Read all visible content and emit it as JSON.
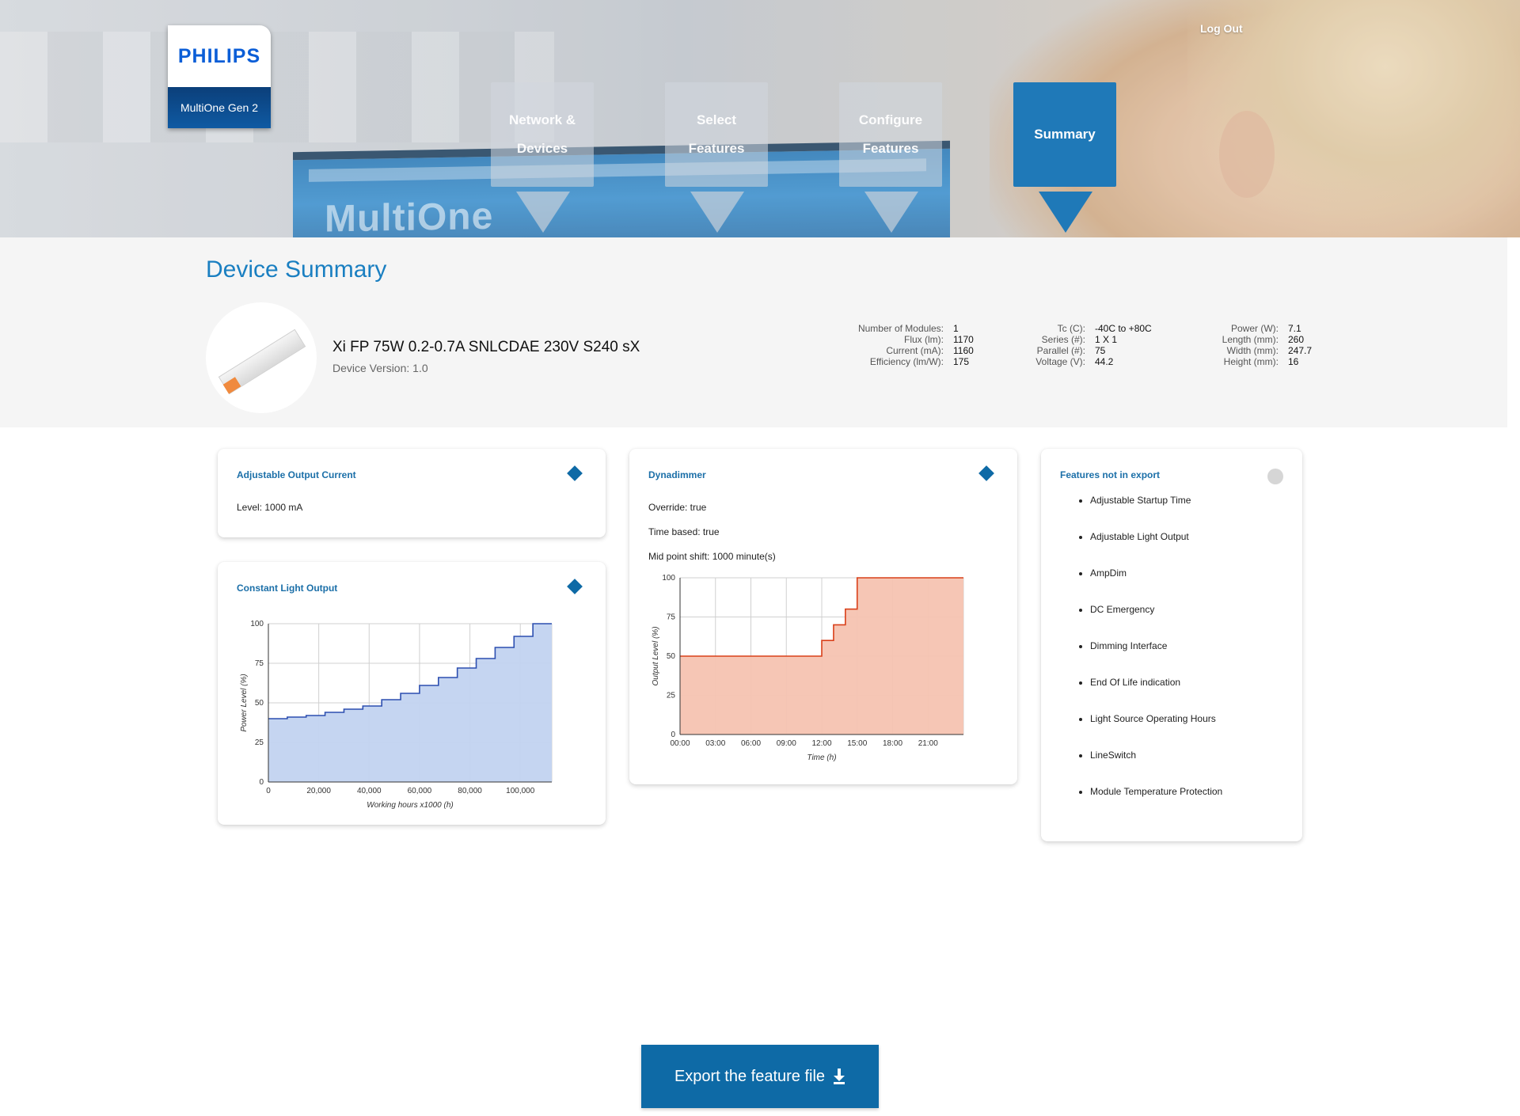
{
  "header": {
    "logo": {
      "brand": "PHILIPS",
      "product": "MultiOne Gen 2"
    },
    "background_screen_text": "MultiOne",
    "logout_label": "Log Out",
    "steps": [
      {
        "line1": "Network &",
        "line2": "Devices",
        "active": false
      },
      {
        "line1": "Select",
        "line2": "Features",
        "active": false
      },
      {
        "line1": "Configure",
        "line2": "Features",
        "active": false
      },
      {
        "line1": "Summary",
        "line2": "",
        "active": true
      }
    ]
  },
  "device": {
    "section_title": "Device Summary",
    "name": "Xi FP 75W 0.2-0.7A SNLCDAE 230V S240 sX",
    "version": "Device Version: 1.0",
    "specs": [
      [
        {
          "label": "Number of Modules:",
          "value": "1"
        },
        {
          "label": "Flux (lm):",
          "value": "1170"
        },
        {
          "label": "Current (mA):",
          "value": "1160"
        },
        {
          "label": "Efficiency (lm/W):",
          "value": "175"
        }
      ],
      [
        {
          "label": "Tc (C):",
          "value": "-40C to +80C"
        },
        {
          "label": "Series (#):",
          "value": "1 X 1"
        },
        {
          "label": "Parallel (#):",
          "value": "75"
        },
        {
          "label": "Voltage (V):",
          "value": "44.2"
        }
      ],
      [
        {
          "label": "Power (W):",
          "value": "7.1"
        },
        {
          "label": "Length (mm):",
          "value": "260"
        },
        {
          "label": "Width (mm):",
          "value": "247.7"
        },
        {
          "label": "Height (mm):",
          "value": "16"
        }
      ]
    ]
  },
  "cards": {
    "aoc": {
      "title": "Adjustable Output Current",
      "level": "Level: 1000 mA"
    },
    "clo": {
      "title": "Constant Light Output"
    },
    "dyna": {
      "title": "Dynadimmer",
      "override": "Override: true",
      "time_based": "Time based: true",
      "mid_point": "Mid point shift: 1000 minute(s)"
    },
    "not_export": {
      "title": "Features not in export",
      "items": [
        "Adjustable Startup Time",
        "Adjustable Light Output",
        "AmpDim",
        "DC Emergency",
        "Dimming Interface",
        "End Of Life indication",
        "Light Source Operating Hours",
        "LineSwitch",
        "Module Temperature Protection"
      ]
    }
  },
  "export_button": {
    "label": "Export the feature file"
  },
  "colors": {
    "accent": "#0e6aa6",
    "title_blue": "#1a7fc1",
    "clo_fill": "#c2d3f0",
    "clo_line": "#2d4fb0",
    "dyna_fill": "#f5c3b1",
    "dyna_line": "#d9401a"
  },
  "chart_data": [
    {
      "type": "area",
      "title": "Constant Light Output",
      "xlabel": "Working hours x1000 (h)",
      "ylabel": "Power Level (%)",
      "xlim": [
        0,
        112500
      ],
      "ylim": [
        0,
        100
      ],
      "x_ticks": [
        0,
        20000,
        40000,
        60000,
        80000,
        100000
      ],
      "x_tick_labels": [
        "0",
        "20,000",
        "40,000",
        "60,000",
        "80,000",
        "100,000"
      ],
      "y_ticks": [
        0,
        25,
        50,
        75,
        100
      ],
      "step": true,
      "x": [
        0,
        7500,
        15000,
        22500,
        30000,
        37500,
        45000,
        52500,
        60000,
        67500,
        75000,
        82500,
        90000,
        97500,
        105000,
        112500
      ],
      "y": [
        40,
        41,
        42,
        44,
        46,
        48,
        52,
        56,
        61,
        66,
        72,
        78,
        85,
        92,
        100,
        100
      ],
      "grid": true
    },
    {
      "type": "area",
      "title": "Dynadimmer",
      "xlabel": "Time (h)",
      "ylabel": "Output Level (%)",
      "xlim": [
        0,
        24
      ],
      "ylim": [
        0,
        100
      ],
      "x_ticks": [
        0,
        3,
        6,
        9,
        12,
        15,
        18,
        21
      ],
      "x_tick_labels": [
        "00:00",
        "03:00",
        "06:00",
        "09:00",
        "12:00",
        "15:00",
        "18:00",
        "21:00"
      ],
      "y_ticks": [
        0,
        25,
        50,
        75,
        100
      ],
      "step": true,
      "x": [
        0,
        12,
        13,
        14,
        15,
        24
      ],
      "y": [
        50,
        60,
        70,
        80,
        100,
        100
      ],
      "grid": true
    }
  ]
}
